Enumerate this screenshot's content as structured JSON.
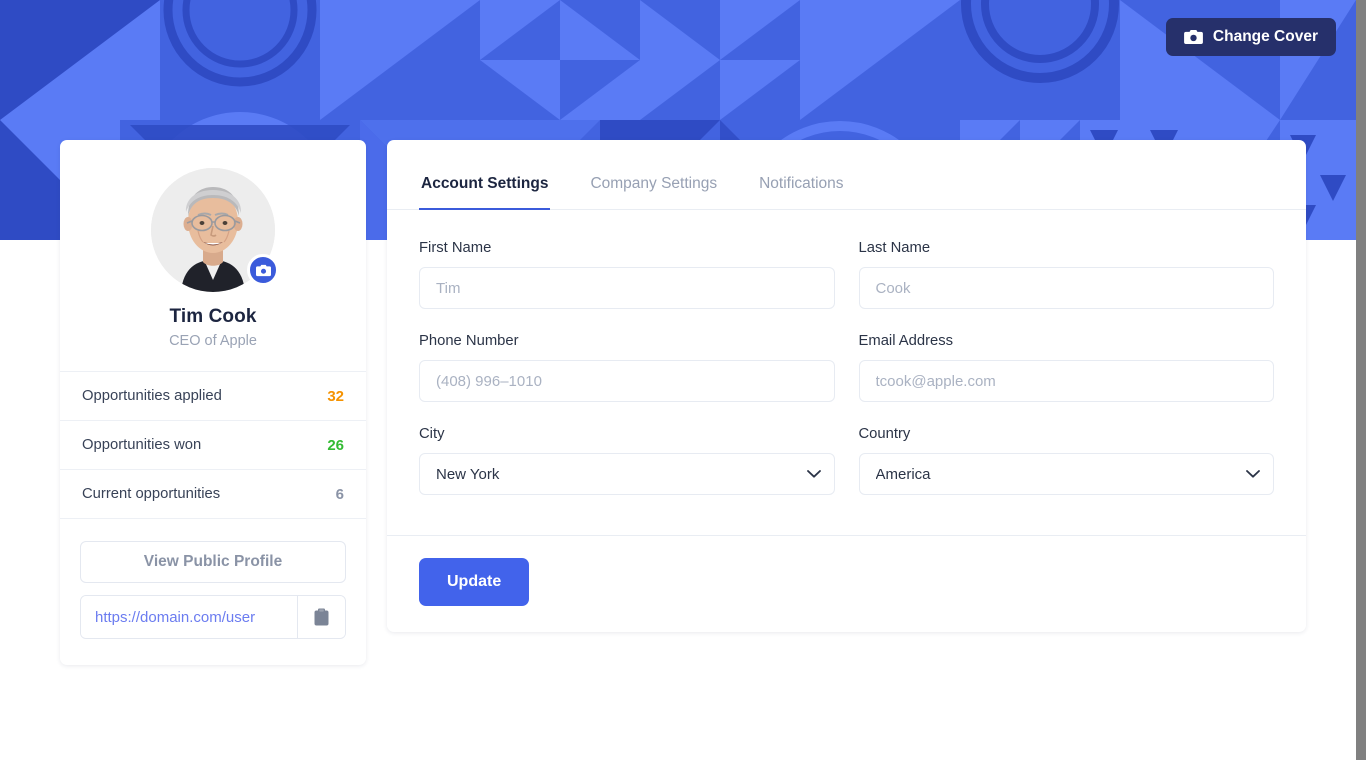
{
  "cover": {
    "change_cover_label": "Change Cover",
    "camera_icon": "camera-icon",
    "background_color": "#4263e0",
    "pattern_light": "#5a7bf5",
    "pattern_dark": "#2f4bc4"
  },
  "profile": {
    "avatar_alt": "Tim Cook portrait",
    "avatar_camera_icon": "camera-icon",
    "name": "Tim Cook",
    "role": "CEO of Apple",
    "stats": [
      {
        "label": "Opportunities applied",
        "value": "32",
        "color": "#f59200"
      },
      {
        "label": "Opportunities won",
        "value": "26",
        "color": "#33bb33"
      },
      {
        "label": "Current opportunities",
        "value": "6",
        "color": "#8a93a6"
      }
    ],
    "view_public_profile_label": "View Public Profile",
    "profile_url": "https://domain.com/user",
    "copy_icon": "clipboard-icon"
  },
  "settings": {
    "tabs": [
      {
        "label": "Account Settings",
        "active": true
      },
      {
        "label": "Company Settings",
        "active": false
      },
      {
        "label": "Notifications",
        "active": false
      }
    ],
    "fields": {
      "first_name": {
        "label": "First Name",
        "value": "",
        "placeholder": "Tim"
      },
      "last_name": {
        "label": "Last Name",
        "value": "",
        "placeholder": "Cook"
      },
      "phone_number": {
        "label": "Phone Number",
        "value": "",
        "placeholder": "(408) 996–1010"
      },
      "email_address": {
        "label": "Email Address",
        "value": "",
        "placeholder": "tcook@apple.com"
      },
      "city": {
        "label": "City",
        "selected": "New York",
        "options": [
          "New York"
        ]
      },
      "country": {
        "label": "Country",
        "selected": "America",
        "options": [
          "America"
        ]
      }
    },
    "update_label": "Update",
    "accent_color": "#4263eb"
  }
}
